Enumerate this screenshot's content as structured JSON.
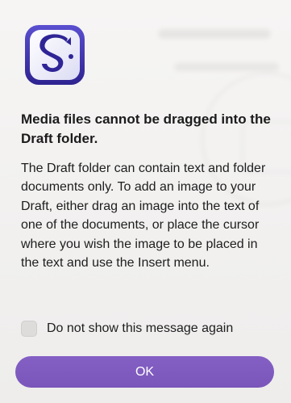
{
  "dialog": {
    "app_icon": "scrivener-s-icon",
    "title": "Media files cannot be dragged into the Draft folder.",
    "message": "The Draft folder can contain text and folder documents only. To add an image to your Draft, either drag an image into the text of one of the documents, or place the cursor where you wish the image to be placed in the text and use the Insert menu.",
    "suppress_checkbox": {
      "label": "Do not show this message again",
      "checked": false
    },
    "ok_label": "OK"
  },
  "colors": {
    "accent": "#7d59be",
    "icon_blue": "#3a2e9c",
    "background": "#f3f2f1"
  }
}
